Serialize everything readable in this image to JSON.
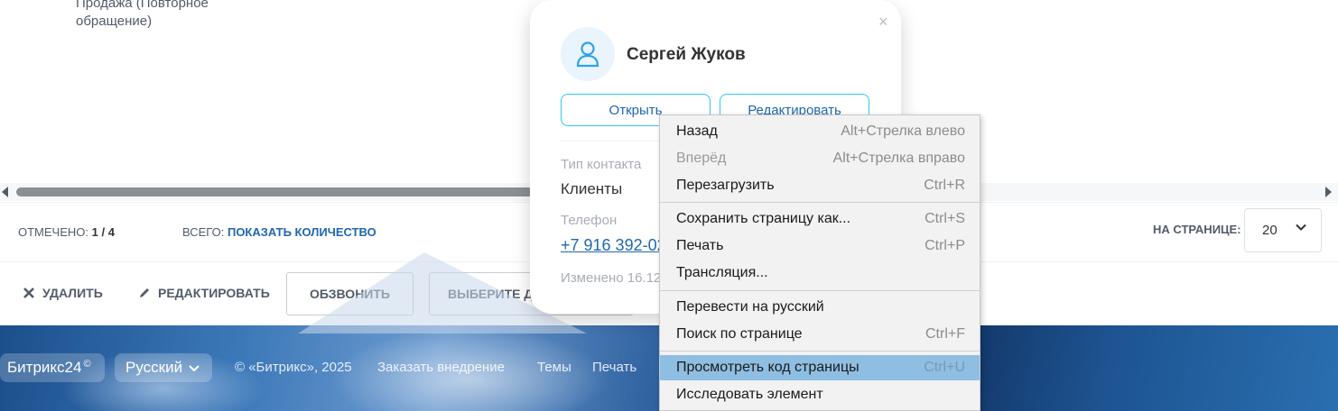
{
  "grid": {
    "cell_text": "Продажа (Повторное обращение)"
  },
  "counters": {
    "marked_label": "ОТМЕЧЕНО:",
    "marked_value": "1 / 4",
    "total_label": "ВСЕГО:",
    "total_link": "ПОКАЗАТЬ КОЛИЧЕСТВО",
    "per_page_label": "НА СТРАНИЦЕ:",
    "per_page_value": "20"
  },
  "actions": {
    "delete": "УДАЛИТЬ",
    "edit": "РЕДАКТИРОВАТЬ",
    "call": "ОБЗВОНИТЬ",
    "choose": "ВЫБЕРИТЕ Д"
  },
  "popup": {
    "close": "×",
    "name": "Сергей Жуков",
    "open_button": "Открыть",
    "edit_button": "Редактировать",
    "contact_type_label": "Тип контакта",
    "contact_type_value": "Клиенты",
    "phone_label": "Телефон",
    "phone_value": "+7 916 392-02",
    "modified": "Изменено 16.12"
  },
  "context_menu": {
    "items": [
      {
        "label": "Назад",
        "shortcut": "Alt+Стрелка влево"
      },
      {
        "label": "Вперёд",
        "shortcut": "Alt+Стрелка вправо"
      },
      {
        "label": "Перезагрузить",
        "shortcut": "Ctrl+R"
      },
      {
        "label": "Сохранить страницу как...",
        "shortcut": "Ctrl+S"
      },
      {
        "label": "Печать",
        "shortcut": "Ctrl+P"
      },
      {
        "label": "Трансляция...",
        "shortcut": ""
      },
      {
        "label": "Перевести на русский",
        "shortcut": ""
      },
      {
        "label": "Поиск по странице",
        "shortcut": "Ctrl+F"
      },
      {
        "label": "Просмотреть код страницы",
        "shortcut": "Ctrl+U"
      },
      {
        "label": "Исследовать элемент",
        "shortcut": ""
      }
    ]
  },
  "footer": {
    "brand": "Битрикс24",
    "brand_mark": "©",
    "language": "Русский",
    "copyright": "© «Битрикс», 2025",
    "order": "Заказать внедрение",
    "themes": "Темы",
    "print": "Печать"
  },
  "colors": {
    "link": "#2067b0",
    "accent_border": "#2fc6f6",
    "menu_highlight": "#8fbee3"
  }
}
